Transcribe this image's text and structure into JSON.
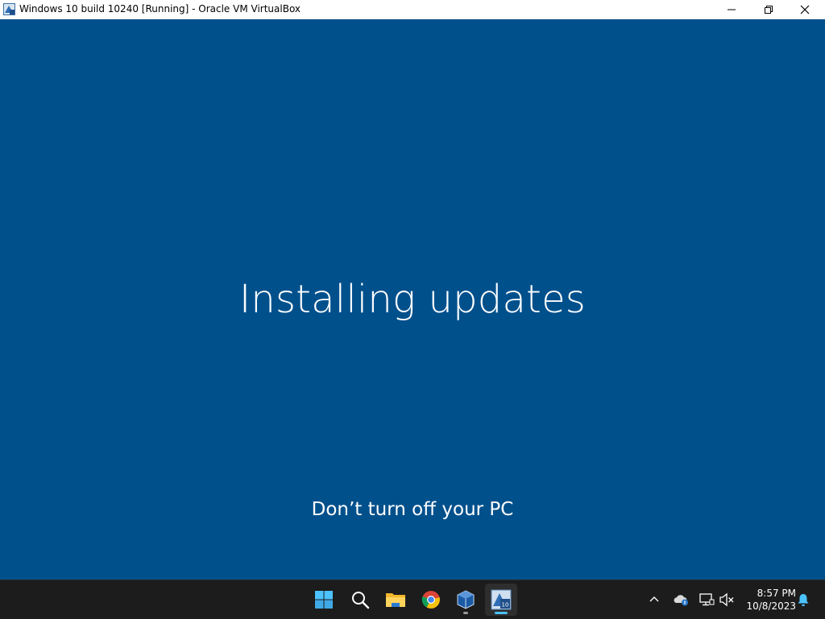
{
  "window": {
    "title": "Windows 10 build 10240 [Running] - Oracle VM VirtualBox",
    "app_icon": "virtualbox-vm-icon",
    "controls": [
      "minimize-icon",
      "restore-icon",
      "close-icon"
    ]
  },
  "guest_screen": {
    "background_color": "#00508c",
    "main_message": "Installing updates",
    "sub_message": "Don’t turn off your PC"
  },
  "taskbar": {
    "apps": [
      {
        "name": "start",
        "icon": "windows-start-icon"
      },
      {
        "name": "search",
        "icon": "search-icon"
      },
      {
        "name": "file-explorer",
        "icon": "folder-icon"
      },
      {
        "name": "chrome",
        "icon": "chrome-icon",
        "running": true
      },
      {
        "name": "virtualbox-manager",
        "icon": "virtualbox-icon",
        "running": true
      },
      {
        "name": "virtualbox-vm",
        "icon": "virtualbox-vm-icon",
        "running": true,
        "active": true
      }
    ],
    "tray": {
      "icons": [
        "chevron-up-icon",
        "onedrive-icon",
        "network-icon",
        "volume-muted-icon",
        "notification-bell-icon"
      ],
      "time": "8:57 PM",
      "date": "10/8/2023"
    },
    "accent_color": "#4cc2ff"
  }
}
